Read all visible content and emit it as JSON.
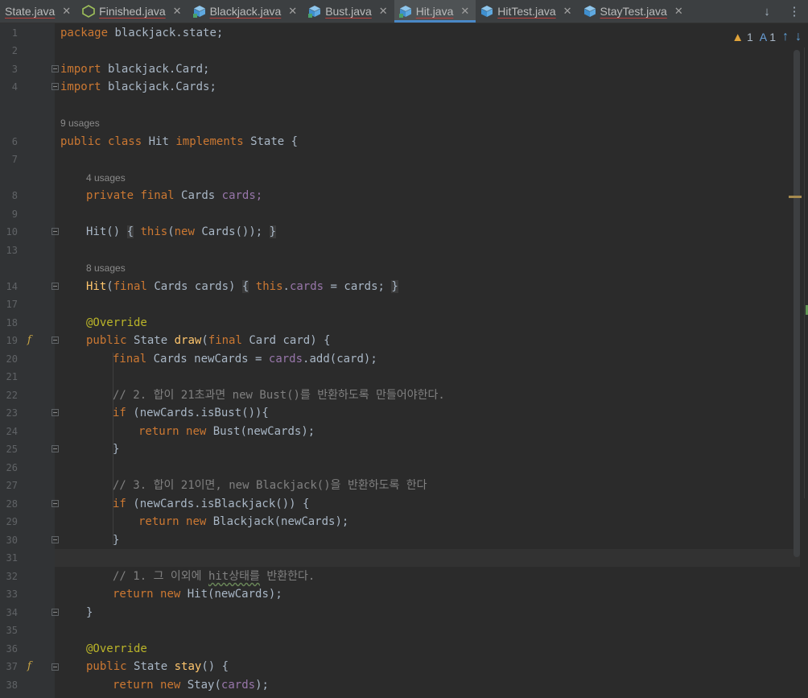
{
  "tabs": [
    {
      "label": "State.java",
      "icon": "interface-icon",
      "active": false
    },
    {
      "label": "Finished.java",
      "icon": "abstract-class-icon",
      "active": false
    },
    {
      "label": "Blackjack.java",
      "icon": "class-icon",
      "active": false
    },
    {
      "label": "Bust.java",
      "icon": "class-icon",
      "active": false
    },
    {
      "label": "Hit.java",
      "icon": "class-icon",
      "active": true
    },
    {
      "label": "HitTest.java",
      "icon": "test-class-icon",
      "active": false
    },
    {
      "label": "StayTest.java",
      "icon": "test-class-icon",
      "active": false
    }
  ],
  "tab_close_glyph": "✕",
  "inspections": {
    "warnings": "1",
    "typos": "1"
  },
  "usages": {
    "u9": "9 usages",
    "u4": "4 usages",
    "u8": "8 usages"
  },
  "code": {
    "pkg_kw": "package",
    "pkg_name": " blackjack.state;",
    "imp_kw": "import",
    "imp1": " blackjack.Card;",
    "imp2": " blackjack.Cards;",
    "cls": {
      "public": "public",
      "class": "class",
      "name": "Hit",
      "implements": "implements",
      "iface": "State",
      "brace": "{"
    },
    "field": {
      "private": "private",
      "final": "final",
      "type": "Cards",
      "name": "cards;"
    },
    "ctor1": {
      "name": "Hit",
      "paren": "()",
      "lbrace": "{",
      "this": "this",
      "open": "(",
      "new": "new",
      "call": "Cards());",
      "rbrace": "}"
    },
    "ctor2": {
      "name": "Hit",
      "open": "(",
      "final": "final",
      "param": "Cards cards)",
      "lbrace": "{",
      "this": "this",
      "dot": ".",
      "field": "cards",
      "assign": " = cards;",
      "rbrace": "}"
    },
    "override": "@Override",
    "draw": {
      "public": "public",
      "ret": "State",
      "name": "draw",
      "open": "(",
      "final": "final",
      "params": "Card card) {"
    },
    "l20": {
      "final": "final",
      "decl": "Cards newCards = ",
      "field": "cards",
      "rest": ".add(card);"
    },
    "c22": "// 2. 합이 21초과면 new Bust()를 반환하도록 만들어야한다.",
    "l23": {
      "if": "if",
      "rest": " (newCards.isBust()){"
    },
    "l24": {
      "return": "return",
      "new": "new",
      "rest": "Bust(newCards);"
    },
    "close": "}",
    "c27": "// 3. 합이 21이면, new Blackjack()을 반환하도록 한다",
    "l28": {
      "if": "if",
      "rest": " (newCards.isBlackjack()) {"
    },
    "l29": {
      "return": "return",
      "new": "new",
      "rest": "Blackjack(newCards);"
    },
    "c32a": "// 1. 그 이외에 ",
    "c32b": "hit상태를",
    "c32c": " 반환한다.",
    "l33": {
      "return": "return",
      "new": "new",
      "rest": "Hit(newCards);"
    },
    "stay": {
      "public": "public",
      "ret": "State",
      "name": "stay",
      "rest": "() {"
    },
    "l38": {
      "return": "return",
      "new": "new",
      "rest": "Stay(",
      "field": "cards",
      "end": ");"
    }
  },
  "line_numbers": [
    "1",
    "2",
    "3",
    "4",
    "6",
    "7",
    "8",
    "9",
    "10",
    "13",
    "14",
    "17",
    "18",
    "19",
    "20",
    "21",
    "22",
    "23",
    "24",
    "25",
    "26",
    "27",
    "28",
    "29",
    "30",
    "31",
    "32",
    "33",
    "34",
    "35",
    "36",
    "37",
    "38"
  ]
}
